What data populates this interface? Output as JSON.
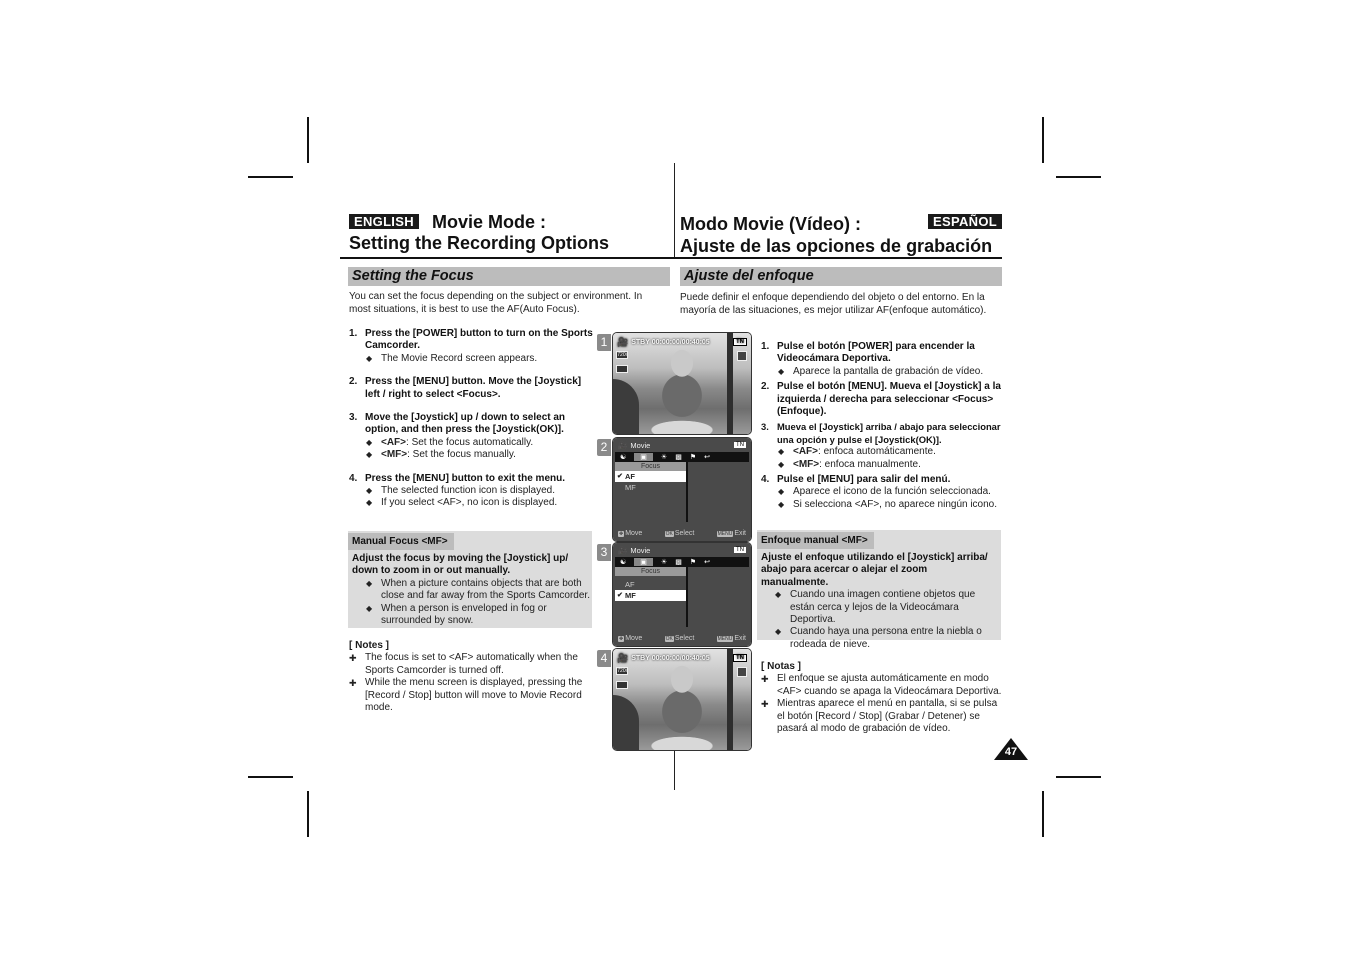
{
  "english": {
    "lang_badge": "ENGLISH",
    "title_line1": "Movie Mode :",
    "title_line2": "Setting the Recording Options",
    "section": "Setting the Focus",
    "intro": "You can set the focus depending on the subject or environment. In most situations, it is best to use the AF(Auto Focus).",
    "steps": [
      {
        "num": "1.",
        "text": "Press the [POWER] button to turn on the Sports Camcorder.",
        "bullets": [
          {
            "key": "",
            "text": "The Movie Record screen appears."
          }
        ]
      },
      {
        "num": "2.",
        "text": "Press the [MENU] button. Move the [Joystick] left / right to select <Focus>.",
        "bullets": []
      },
      {
        "num": "3.",
        "text": "Move the [Joystick] up / down to select an option, and then press the [Joystick(OK)].",
        "bullets": [
          {
            "key": "<AF>",
            "text": ": Set the focus automatically."
          },
          {
            "key": "<MF>",
            "text": ": Set the focus manually."
          }
        ]
      },
      {
        "num": "4.",
        "text": "Press the [MENU] button to exit the menu.",
        "bullets": [
          {
            "key": "",
            "text": "The selected function icon is displayed."
          },
          {
            "key": "",
            "text": "If you select <AF>, no icon is displayed."
          }
        ]
      }
    ],
    "mf": {
      "heading": "Manual Focus <MF>",
      "lead": "Adjust the focus by moving the [Joystick] up/ down to zoom in or out manually.",
      "bullets": [
        "When a picture contains objects that are both close and far away from the Sports Camcorder.",
        "When a person is enveloped in fog or surrounded by snow."
      ]
    },
    "notes": {
      "title": "[ Notes ]",
      "items": [
        "The focus is set to <AF> automatically when the Sports Camcorder is turned off.",
        "While the menu screen is displayed, pressing the [Record / Stop] button will move to Movie Record mode."
      ]
    }
  },
  "spanish": {
    "lang_badge": "ESPAÑOL",
    "title_line1": "Modo Movie (Vídeo) :",
    "title_line2": "Ajuste de las opciones de grabación",
    "section": "Ajuste del enfoque",
    "intro": "Puede definir el enfoque dependiendo del objeto o del entorno. En la mayoría de las situaciones, es mejor utilizar AF(enfoque automático).",
    "steps": [
      {
        "num": "1.",
        "text": "Pulse el botón [POWER] para encender la Videocámara Deportiva.",
        "bullets": [
          {
            "key": "",
            "text": "Aparece la pantalla de grabación de vídeo."
          }
        ]
      },
      {
        "num": "2.",
        "text": "Pulse el botón [MENU]. Mueva el [Joystick] a la izquierda / derecha para seleccionar <Focus> (Enfoque).",
        "bullets": []
      },
      {
        "num": "3.",
        "text": "Mueva el [Joystick] arriba / abajo para seleccionar una opción y pulse el [Joystick(OK)].",
        "bullets": [
          {
            "key": "<AF>",
            "text": ": enfoca automáticamente."
          },
          {
            "key": "<MF>",
            "text": ": enfoca manualmente."
          }
        ]
      },
      {
        "num": "4.",
        "text": "Pulse el [MENU] para salir del menú.",
        "bullets": [
          {
            "key": "",
            "text": "Aparece el icono de la función seleccionada."
          },
          {
            "key": "",
            "text": "Si selecciona <AF>, no aparece ningún icono."
          }
        ]
      }
    ],
    "mf": {
      "heading": "Enfoque manual <MF>",
      "lead": "Ajuste el enfoque utilizando el [Joystick] arriba/ abajo para acercar o alejar el zoom manualmente.",
      "bullets": [
        "Cuando una imagen contiene objetos que están cerca y lejos de la Videocámara Deportiva.",
        "Cuando haya una persona entre la niebla o rodeada de nieve."
      ]
    },
    "notes": {
      "title": "[ Notas ]",
      "items": [
        "El enfoque se ajusta automáticamente en modo <AF> cuando se apaga la Videocámara Deportiva.",
        "Mientras aparece el menú en pantalla, si se pulsa el botón [Record / Stop] (Grabar / Detener) se pasará al modo de grabación de vídeo."
      ]
    }
  },
  "screens": {
    "s1": {
      "num": "1",
      "status": "STBY 00:00:00/00:40:05",
      "battery": "TN",
      "res": "720i",
      "icon": "movie-camera-icon"
    },
    "s2": {
      "num": "2",
      "mode": "Movie",
      "battery": "TN",
      "menu_title": "Focus",
      "options": [
        "AF",
        "MF"
      ],
      "selected": "AF",
      "foot_move": "Move",
      "foot_select": "Select",
      "foot_exit": "Exit",
      "key_ok": "OK",
      "key_menu": "MENU"
    },
    "s3": {
      "num": "3",
      "mode": "Movie",
      "battery": "TN",
      "menu_title": "Focus",
      "options": [
        "AF",
        "MF"
      ],
      "selected": "MF",
      "foot_move": "Move",
      "foot_select": "Select",
      "foot_exit": "Exit",
      "key_ok": "OK",
      "key_menu": "MENU"
    },
    "s4": {
      "num": "4",
      "status": "STBY 00:00:00/00:40:05",
      "battery": "TN",
      "res": "720i",
      "icon": "movie-camera-icon"
    }
  },
  "page_number": "47"
}
